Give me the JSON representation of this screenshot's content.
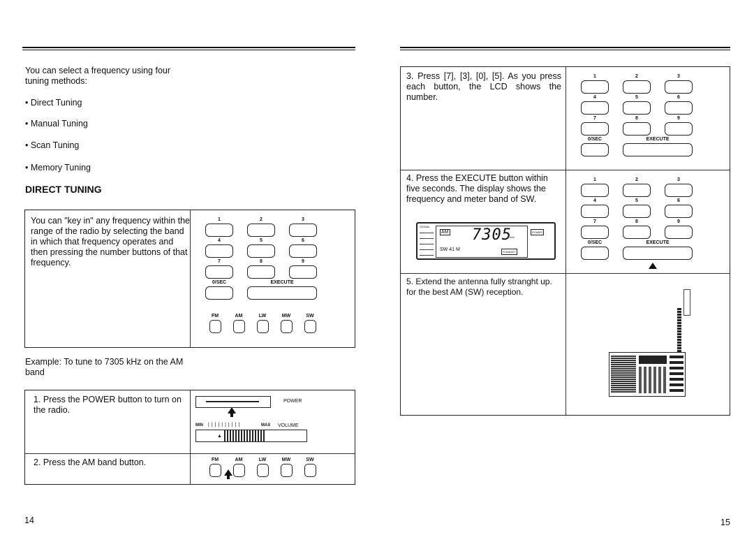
{
  "left_page": {
    "intro": "You can select a frequency using four tuning methods:",
    "methods": [
      "• Direct Tuning",
      "• Manual Tuning",
      "• Scan Tuning",
      "• Memory Tuning"
    ],
    "heading": "DIRECT TUNING",
    "box_text": "You can \"key in\" any frequency within the range of the radio by selecting the band in which that frequency operates and then pressing the number buttons of that frequency.",
    "example": "Example: To tune to 7305 kHz on the AM band",
    "steps": [
      "1. Press the POWER button to turn on the radio.",
      "2. Press the AM band button."
    ],
    "power_label": "POWER",
    "volume_min": "MIN",
    "volume_max": "MAX",
    "volume_label": "VOLUME",
    "page_number": "14"
  },
  "keypad": {
    "keys": [
      "1",
      "2",
      "3",
      "4",
      "5",
      "6",
      "7",
      "8",
      "9"
    ],
    "sec": "0/SEC",
    "execute": "EXECUTE",
    "bands": [
      "FM",
      "AM",
      "LW",
      "MW",
      "SW"
    ]
  },
  "right_page": {
    "steps": [
      "3. Press [7], [3], [0], [5]. As you press each button, the LCD shows the number.",
      "4. Press the EXECUTE button within five seconds. The display shows the frequency and meter band of SW.",
      "5. Extend the antenna fully stranght up. for the best AM (SW) reception."
    ],
    "lcd": {
      "band": "AM",
      "frequency": "7305",
      "unit": "kHz",
      "meter": "SW 41 M",
      "signal": "SIGNAL",
      "standby": "STANDBY",
      "power": "POWER"
    },
    "page_number": "15"
  }
}
